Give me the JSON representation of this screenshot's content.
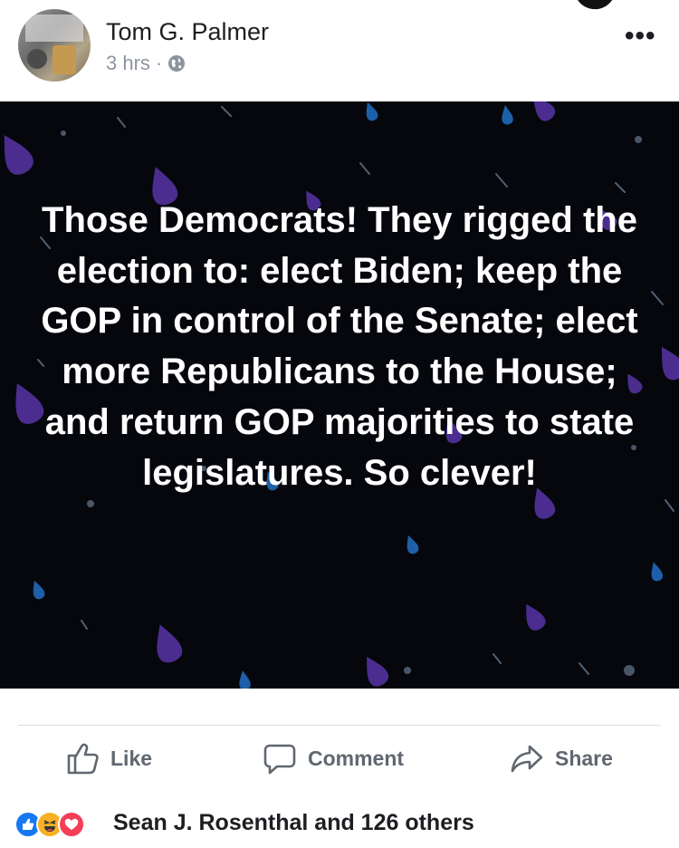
{
  "post": {
    "author": "Tom G. Palmer",
    "timestamp": "3 hrs",
    "separator": "·",
    "privacy_icon": "globe-icon",
    "more_label": "•••",
    "text": "Those Democrats! They rigged the election to: elect Biden; keep the GOP in control of the Senate; elect more Republicans to the House; and return GOP majorities to state legislatures. So clever!",
    "background_color": "#05070c"
  },
  "actions": {
    "like_label": "Like",
    "comment_label": "Comment",
    "share_label": "Share"
  },
  "reactions": {
    "icons": [
      "like-reaction-icon",
      "haha-reaction-icon",
      "love-reaction-icon"
    ],
    "summary": "Sean J. Rosenthal and 126 others"
  },
  "colors": {
    "accent_blue": "#1877f2",
    "action_gray": "#606770",
    "drop_purple": "#4b2d8f",
    "drop_blue": "#1d5fa8"
  }
}
